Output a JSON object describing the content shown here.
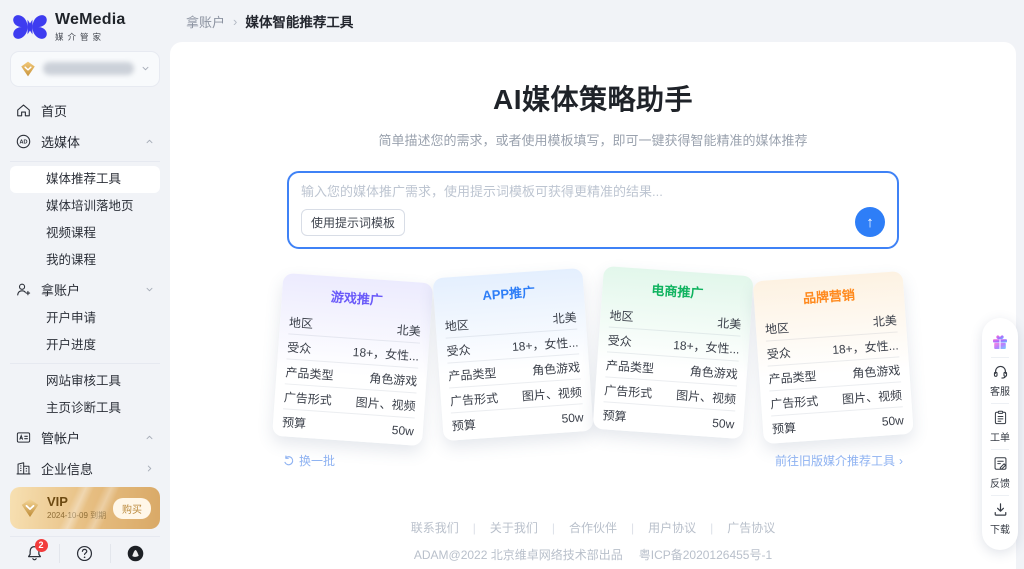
{
  "brand": {
    "name": "WeMedia",
    "tagline": "媒介管家"
  },
  "breadcrumb": {
    "section": "拿账户",
    "separator": "›",
    "current": "媒体智能推荐工具"
  },
  "sidebar": {
    "nav": [
      {
        "key": "home",
        "type": "top",
        "icon": "home",
        "label": "首页"
      },
      {
        "key": "select-media",
        "type": "top",
        "icon": "ad",
        "label": "选媒体",
        "chevron": "up",
        "divider_after": true
      },
      {
        "key": "media-recommend-tool",
        "type": "sub",
        "label": "媒体推荐工具",
        "active": true
      },
      {
        "key": "media-training-page",
        "type": "sub",
        "label": "媒体培训落地页"
      },
      {
        "key": "video-courses",
        "type": "sub",
        "label": "视频课程"
      },
      {
        "key": "my-courses",
        "type": "sub",
        "label": "我的课程"
      },
      {
        "key": "get-account",
        "type": "top",
        "icon": "user-add",
        "label": "拿账户",
        "chevron": "down"
      },
      {
        "key": "account-apply",
        "type": "sub",
        "label": "开户申请"
      },
      {
        "key": "account-progress",
        "type": "sub",
        "label": "开户进度",
        "divider_after": true
      },
      {
        "key": "site-review-tool",
        "type": "sub",
        "label": "网站审核工具"
      },
      {
        "key": "homepage-diagnosis-tool",
        "type": "sub",
        "label": "主页诊断工具"
      },
      {
        "key": "manage-account",
        "type": "top",
        "icon": "card",
        "label": "管帐户",
        "chevron": "up"
      },
      {
        "key": "company-info",
        "type": "top",
        "icon": "building",
        "label": "企业信息",
        "chevron": "right"
      }
    ],
    "vip": {
      "title": "VIP",
      "expiry": "2024-10-09 到期",
      "buy_label": "购买"
    },
    "notification_badge": "2"
  },
  "main": {
    "title": "AI媒体策略助手",
    "subtitle": "简单描述您的需求，或者使用模板填写，即可一键获得智能精准的媒体推荐",
    "prompt": {
      "placeholder": "输入您的媒体推广需求，使用提示词模板可获得更精准的结果...",
      "template_button": "使用提示词模板",
      "send_glyph": "↑"
    },
    "refresh_label": "换一批",
    "legacy_link": {
      "label": "前往旧版媒介推荐工具",
      "arrow": "›"
    }
  },
  "cards": [
    {
      "key": "game-promo",
      "title": "游戏推广",
      "accent": "#6a5af9",
      "tint": "#ecebfe",
      "rows": [
        {
          "label": "地区",
          "value": "北美"
        },
        {
          "label": "受众",
          "value": "18+，女性..."
        },
        {
          "label": "产品类型",
          "value": "角色游戏"
        },
        {
          "label": "广告形式",
          "value": "图片、视频"
        },
        {
          "label": "预算",
          "value": "50w"
        }
      ]
    },
    {
      "key": "app-promo",
      "title": "APP推广",
      "accent": "#2e7ef7",
      "tint": "#e4effe",
      "rows": [
        {
          "label": "地区",
          "value": "北美"
        },
        {
          "label": "受众",
          "value": "18+，女性..."
        },
        {
          "label": "产品类型",
          "value": "角色游戏"
        },
        {
          "label": "广告形式",
          "value": "图片、视频"
        },
        {
          "label": "预算",
          "value": "50w"
        }
      ]
    },
    {
      "key": "ecom-promo",
      "title": "电商推广",
      "accent": "#0fb35f",
      "tint": "#e2f7eb",
      "rows": [
        {
          "label": "地区",
          "value": "北美"
        },
        {
          "label": "受众",
          "value": "18+，女性..."
        },
        {
          "label": "产品类型",
          "value": "角色游戏"
        },
        {
          "label": "广告形式",
          "value": "图片、视频"
        },
        {
          "label": "预算",
          "value": "50w"
        }
      ]
    },
    {
      "key": "brand-marketing",
      "title": "品牌营销",
      "accent": "#ff8a1e",
      "tint": "#fdf2e2",
      "rows": [
        {
          "label": "地区",
          "value": "北美"
        },
        {
          "label": "受众",
          "value": "18+，女性..."
        },
        {
          "label": "产品类型",
          "value": "角色游戏"
        },
        {
          "label": "广告形式",
          "value": "图片、视频"
        },
        {
          "label": "预算",
          "value": "50w"
        }
      ]
    }
  ],
  "float_toolbar": [
    {
      "key": "benefits",
      "icon": "gift",
      "label": ""
    },
    {
      "key": "customer-service",
      "icon": "headset",
      "label": "客服"
    },
    {
      "key": "work-order",
      "icon": "ticket",
      "label": "工单"
    },
    {
      "key": "feedback",
      "icon": "feedback",
      "label": "反馈"
    },
    {
      "key": "download",
      "icon": "download",
      "label": "下载"
    }
  ],
  "footer": {
    "links": [
      {
        "key": "contact-us",
        "label": "联系我们"
      },
      {
        "key": "about-us",
        "label": "关于我们"
      },
      {
        "key": "partners",
        "label": "合作伙伴"
      },
      {
        "key": "user-agreement",
        "label": "用户协议"
      },
      {
        "key": "ad-agreement",
        "label": "广告协议"
      }
    ],
    "separator": "|",
    "copyright": "ADAM@2022 北京维卓网络技术部出品",
    "icp": "粤ICP备2020126455号-1"
  },
  "colors": {
    "accent_blue": "#2e7ef7",
    "vip_gold": "#e6bd80",
    "logo_blue": "#3e3cf0"
  }
}
